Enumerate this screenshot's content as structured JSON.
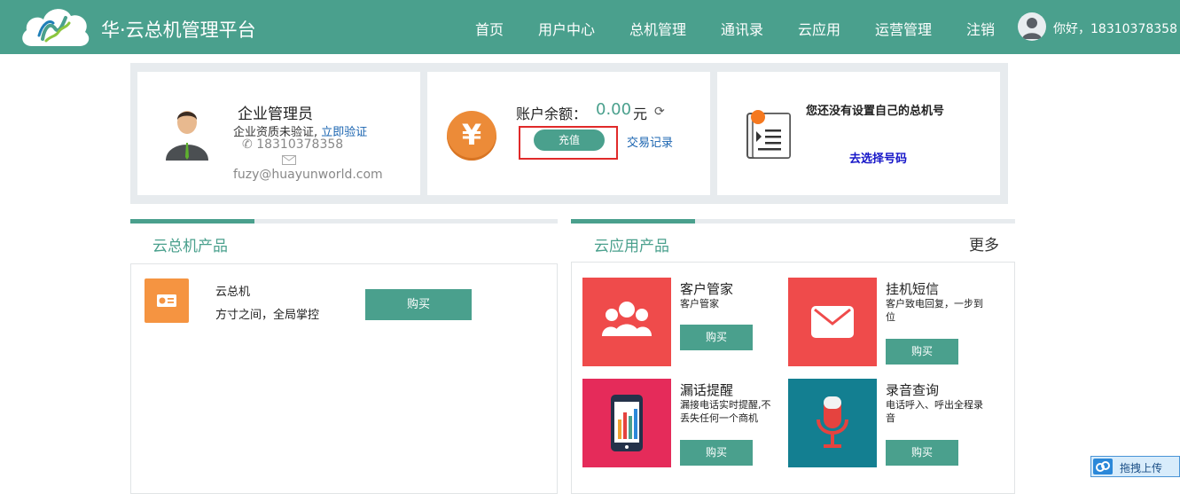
{
  "header": {
    "brand": "华·云总机管理平台",
    "nav": [
      "首页",
      "用户中心",
      "总机管理",
      "通讯录",
      "云应用",
      "运营管理",
      "注销"
    ],
    "greeting": "你好，18310378358"
  },
  "admin_card": {
    "title": "企业管理员",
    "verify_text": "企业资质未验证,",
    "verify_link": "立即验证",
    "phone": "18310378358",
    "email": "fuzy@huayunworld.com"
  },
  "balance_card": {
    "yen_symbol": "¥",
    "label": "账户余额：",
    "value": "0.00",
    "unit": "元",
    "charge_button": "充值",
    "trade_link": "交易记录"
  },
  "switch_card": {
    "notice": "您还没有设置自己的总机号",
    "choose_link": "去选择号码"
  },
  "cloud_pbx": {
    "title": "云总机产品",
    "product_name": "云总机",
    "product_desc": "方寸之间，全局掌控",
    "buy_label": "购买"
  },
  "cloud_apps": {
    "title": "云应用产品",
    "more": "更多",
    "items": [
      {
        "title": "客户管家",
        "desc": "客户管家",
        "buy": "购买",
        "color": "#ef4b4b"
      },
      {
        "title": "挂机短信",
        "desc": "客户致电回复，一步到位",
        "buy": "购买",
        "color": "#ef4b4b"
      },
      {
        "title": "漏话提醒",
        "desc": "漏接电话实时提醒,不丢失任何一个商机",
        "buy": "购买",
        "color": "#e52b5a"
      },
      {
        "title": "录音查询",
        "desc": "电话呼入、呼出全程录音",
        "buy": "购买",
        "color": "#137f91"
      }
    ]
  },
  "upload_widget": {
    "label": "拖拽上传"
  },
  "colors": {
    "brand": "#4aa08d",
    "link": "#1a64b0",
    "highlight_box": "#e02a2a"
  }
}
